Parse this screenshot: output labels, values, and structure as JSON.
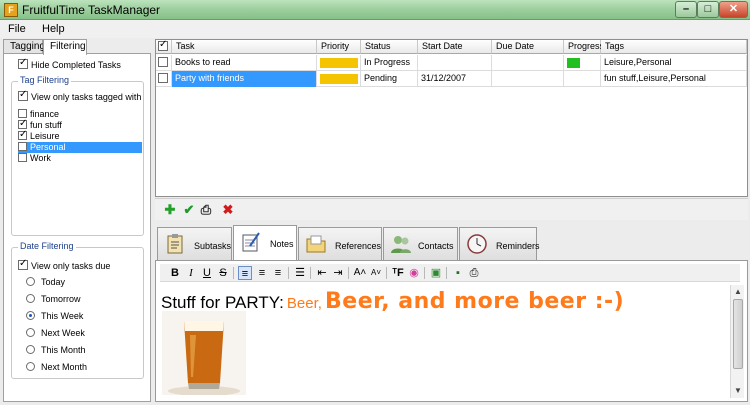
{
  "window": {
    "title": "FruitfulTime TaskManager",
    "app_icon_letter": "F",
    "min": "–",
    "max": "□",
    "close": "✕"
  },
  "menu": {
    "file": "File",
    "help": "Help"
  },
  "left": {
    "tabs": [
      "Tagging",
      "Filtering"
    ],
    "active_tab": "Filtering",
    "hide_completed": {
      "label": "Hide Completed Tasks",
      "checked": true
    },
    "tag_filtering": {
      "title": "Tag Filtering",
      "view_only_label": "View only tasks tagged with",
      "view_only_checked": true,
      "tags": [
        {
          "name": "finance",
          "checked": false
        },
        {
          "name": "fun stuff",
          "checked": true
        },
        {
          "name": "Leisure",
          "checked": true
        },
        {
          "name": "Personal",
          "checked": false,
          "selected": true
        },
        {
          "name": "Work",
          "checked": false
        }
      ]
    },
    "date_filtering": {
      "title": "Date Filtering",
      "view_only_label": "View only tasks due",
      "view_only_checked": true,
      "options": [
        "Today",
        "Tomorrow",
        "This Week",
        "Next Week",
        "This Month",
        "Next Month"
      ],
      "selected": "This Week"
    }
  },
  "grid": {
    "columns": [
      "Task",
      "Priority",
      "Status",
      "Start Date",
      "Due Date",
      "Progress",
      "Tags"
    ],
    "rows": [
      {
        "task": "Books to read",
        "priority": "medium",
        "status": "In Progress",
        "start": "",
        "due": "",
        "progress_pct": 10,
        "tags": "Leisure,Personal"
      },
      {
        "task": "Party with friends",
        "priority": "medium",
        "status": "Pending",
        "start": "31/12/2007",
        "due": "",
        "progress_pct": 0,
        "tags": "fun stuff,Leisure,Personal"
      }
    ],
    "colors": {
      "priority": "#f5c400",
      "progress": "#20c020",
      "selection": "#3399ff"
    }
  },
  "toolbar": {
    "icons": [
      "add-icon",
      "complete-icon",
      "print-icon",
      "delete-icon"
    ]
  },
  "bottom_tabs": [
    "Subtasks",
    "Notes",
    "References",
    "Contacts",
    "Reminders"
  ],
  "active_bottom_tab": "Notes",
  "notes": {
    "part1": "Stuff for PARTY:",
    "part2": "Beer,",
    "part3": "Beer, and more beer :-)",
    "text_color": "#ff7a1a"
  }
}
